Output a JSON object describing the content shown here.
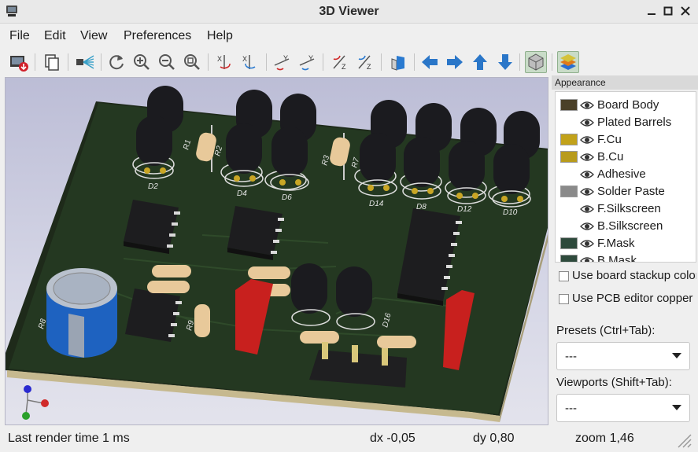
{
  "window": {
    "title": "3D Viewer"
  },
  "menu": [
    "File",
    "Edit",
    "View",
    "Preferences",
    "Help"
  ],
  "toolbar": {
    "icons": [
      "export-image-icon",
      "copy-clipboard-icon",
      "raytracing-icon",
      "reload-icon",
      "zoom-in-icon",
      "zoom-out-icon",
      "zoom-fit-icon",
      "rotate-x-cw-icon",
      "rotate-x-ccw-icon",
      "rotate-y-cw-icon",
      "rotate-y-ccw-icon",
      "rotate-z-cw-icon",
      "rotate-z-ccw-icon",
      "flip-board-icon",
      "pan-left-icon",
      "pan-right-icon",
      "pan-up-icon",
      "pan-down-icon",
      "orthographic-toggle-icon",
      "layers-manager-icon"
    ]
  },
  "viewport": {
    "designators": [
      "R1",
      "R2",
      "R3",
      "R7",
      "R8",
      "R9",
      "D2",
      "D4",
      "D6",
      "D14",
      "D8",
      "D12",
      "D10",
      "D16"
    ]
  },
  "appearance": {
    "header": "Appearance",
    "layers": [
      {
        "name": "Board Body",
        "color": "#4a4028"
      },
      {
        "name": "Plated Barrels",
        "color": ""
      },
      {
        "name": "F.Cu",
        "color": "#c2a21a"
      },
      {
        "name": "B.Cu",
        "color": "#b89b1c"
      },
      {
        "name": "Adhesive",
        "color": ""
      },
      {
        "name": "Solder Paste",
        "color": "#8a8a8a"
      },
      {
        "name": "F.Silkscreen",
        "color": ""
      },
      {
        "name": "B.Silkscreen",
        "color": ""
      },
      {
        "name": "F.Mask",
        "color": "#2e4a3c"
      },
      {
        "name": "B.Mask",
        "color": "#2e4a3c"
      }
    ],
    "options": [
      {
        "label": "Use board stackup colors"
      },
      {
        "label": "Use PCB editor copper colors"
      }
    ],
    "presets_label": "Presets (Ctrl+Tab):",
    "presets_value": "---",
    "viewports_label": "Viewports (Shift+Tab):",
    "viewports_value": "---"
  },
  "status": {
    "render_time": "Last render time 1 ms",
    "dx": "dx -0,05",
    "dy": "dy 0,80",
    "zoom": "zoom 1,46"
  }
}
